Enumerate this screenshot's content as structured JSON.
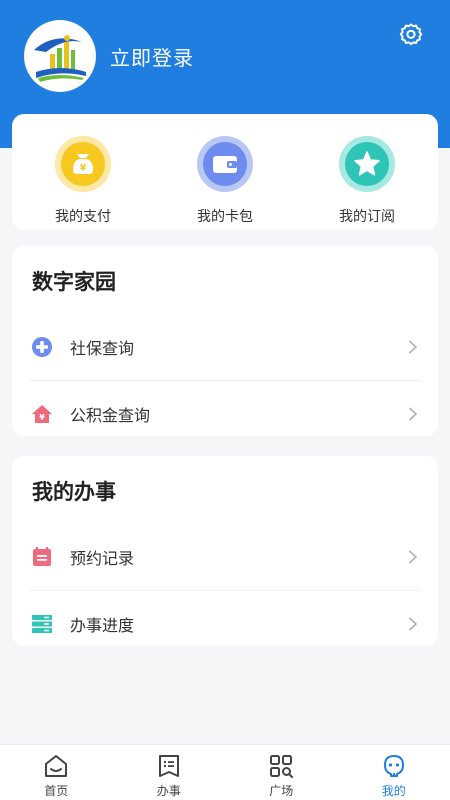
{
  "header": {
    "login_text": "立即登录",
    "color": "#1f7ee0"
  },
  "quick_actions": [
    {
      "label": "我的支付",
      "icon": "money-bag-icon",
      "color": "#f5c518"
    },
    {
      "label": "我的卡包",
      "icon": "wallet-icon",
      "color": "#6e8cf0"
    },
    {
      "label": "我的订阅",
      "icon": "star-icon",
      "color": "#2ec4b6"
    }
  ],
  "digital_home": {
    "title": "数字家园",
    "items": [
      {
        "label": "社保查询",
        "icon": "plus-circle-icon"
      },
      {
        "label": "公积金查询",
        "icon": "house-icon"
      }
    ]
  },
  "my_affairs": {
    "title": "我的办事",
    "items": [
      {
        "label": "预约记录",
        "icon": "calendar-icon"
      },
      {
        "label": "办事进度",
        "icon": "progress-icon"
      }
    ]
  },
  "tabbar": {
    "active": "我的",
    "active_color": "#1f7ee0",
    "items": [
      {
        "label": "首页",
        "icon": "home-icon"
      },
      {
        "label": "办事",
        "icon": "document-icon"
      },
      {
        "label": "广场",
        "icon": "grid-search-icon"
      },
      {
        "label": "我的",
        "icon": "profile-icon"
      }
    ]
  }
}
